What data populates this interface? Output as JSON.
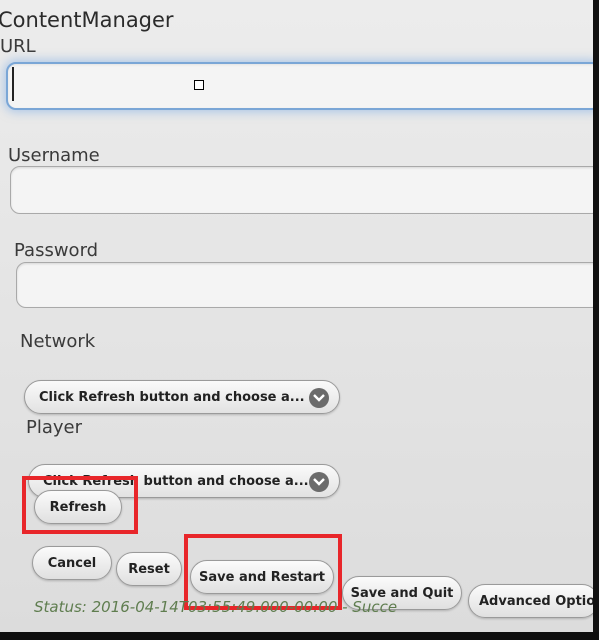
{
  "app": {
    "title": "ContentManager"
  },
  "form": {
    "url": {
      "label": "URL",
      "value": ""
    },
    "username": {
      "label": "Username",
      "value": ""
    },
    "password": {
      "label": "Password",
      "value": ""
    },
    "network": {
      "label": "Network",
      "selected": "Click Refresh button and choose a..."
    },
    "player": {
      "label": "Player",
      "selected": "Click Refresh button and choose a..."
    }
  },
  "buttons": {
    "refresh": "Refresh",
    "cancel": "Cancel",
    "reset": "Reset",
    "save_restart": "Save and Restart",
    "save_quit": "Save and Quit",
    "advanced": "Advanced Optior"
  },
  "status": {
    "text": "Status: 2016-04-14T03:55:49.000-00:00 - Succe"
  },
  "colors": {
    "highlight": "#e8262a",
    "focus": "#7aa6d6",
    "status": "#5f7d4f"
  },
  "icons": {
    "dropdown": "chevron-down-icon"
  }
}
